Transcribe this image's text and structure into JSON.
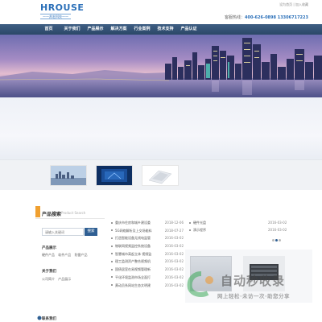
{
  "header": {
    "logo_text": "HROUSE",
    "logo_sub": "——苏宏科技——",
    "top_links": "设为首页 | 加入收藏",
    "hotline_label": "客服热线：",
    "hotline_numbers": "400-626-0898 13306717223"
  },
  "nav": {
    "items": [
      "首页",
      "关于我们",
      "产品展示",
      "解决方案",
      "行业案例",
      "技术支持",
      "产品认证"
    ]
  },
  "search": {
    "title": "产品搜索",
    "title_en": "Product Search",
    "placeholder": "请输入关键词",
    "button": "搜索",
    "cat1_title": "产品展示",
    "cat1_links": [
      "硬件产品",
      "软件产品",
      "防雷产品"
    ],
    "cat2_title": "关于我们",
    "cat2_links": [
      "公司简介",
      "产品展示"
    ],
    "cat3_title": "联系我们"
  },
  "news": [
    {
      "title": "重庆市住房和城乡建设委",
      "date": "2018-12-06"
    },
    {
      "title": "5G网络解析及上交场能料",
      "date": "2018-07-27"
    },
    {
      "title": "打造智能设备无线电监管",
      "date": "2016-03-02"
    },
    {
      "title": "物联网视频监控系统设备",
      "date": "2016-03-02"
    },
    {
      "title": "智慧城市高起立体 视频监",
      "date": "2016-03-02"
    },
    {
      "title": "理工监测资产整合视频机",
      "date": "2016-03-02"
    },
    {
      "title": "国债居室在易视频管理新",
      "date": "2016-03-02"
    },
    {
      "title": "平化环境监测市场全面打",
      "date": "2016-03-02"
    },
    {
      "title": "黄动员系网站生态文明建",
      "date": "2016-03-02"
    }
  ],
  "right_list": [
    {
      "title": "硬件光盘",
      "date": "2016-03-02"
    },
    {
      "title": "演示程序",
      "date": "2016-03-02"
    }
  ],
  "watermark": {
    "text": "自动秒收录",
    "sub": "网上轻松·未访一次·助您分享"
  }
}
